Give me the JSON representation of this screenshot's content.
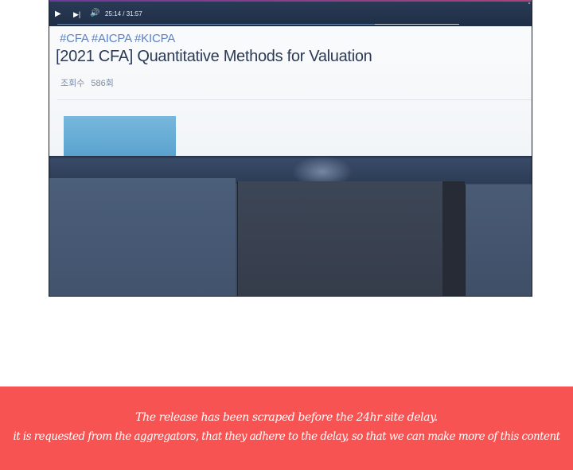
{
  "video_player": {
    "time_readout": "25:14 / 31:57",
    "progress": 0.79,
    "play_icon": "play-icon",
    "next_icon": "skip-next-icon",
    "volume_icon": "volume-icon"
  },
  "lecture": {
    "tags": "#CFA  #AICPA #KICPA",
    "title": "[2021 CFA]  Quantitative Methods for Valuation",
    "views_label": "조회수",
    "views_count": "586회"
  },
  "notice": {
    "line1": "The release has been scraped before the 24hr site delay.",
    "line2": "it is requested from the aggregators, that they adhere to the delay, so that we can make more of this content",
    "background_color": "#f85353"
  }
}
